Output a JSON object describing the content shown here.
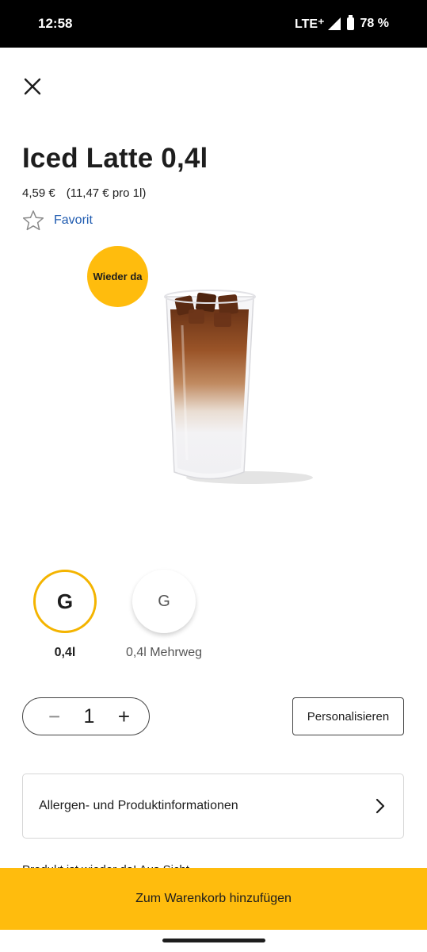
{
  "status_bar": {
    "time": "12:58",
    "network": "LTE⁺",
    "battery": "78 %",
    "signal_icon": "signal-icon",
    "battery_icon": "battery-icon"
  },
  "header": {
    "close_icon": "close-icon"
  },
  "product": {
    "title": "Iced Latte 0,4l",
    "price": "4,59 €",
    "unit_price": "(11,47 € pro 1l)",
    "favorite_label": "Favorit",
    "badge": "Wieder da"
  },
  "sizes": [
    {
      "letter": "G",
      "label": "0,4l",
      "selected": true
    },
    {
      "letter": "G",
      "label": "0,4l Mehrweg",
      "selected": false
    }
  ],
  "quantity": {
    "minus": "−",
    "value": "1",
    "plus": "+"
  },
  "personalize_label": "Personalisieren",
  "info_row_label": "Allergen- und Produktinformationen",
  "partial_text": "Produkt ist wieder da! Aus Sicht",
  "cta_label": "Zum Warenkorb hinzufügen",
  "colors": {
    "accent": "#ffbc0d",
    "selected_ring": "#f4b400",
    "link": "#1f5bb0"
  }
}
